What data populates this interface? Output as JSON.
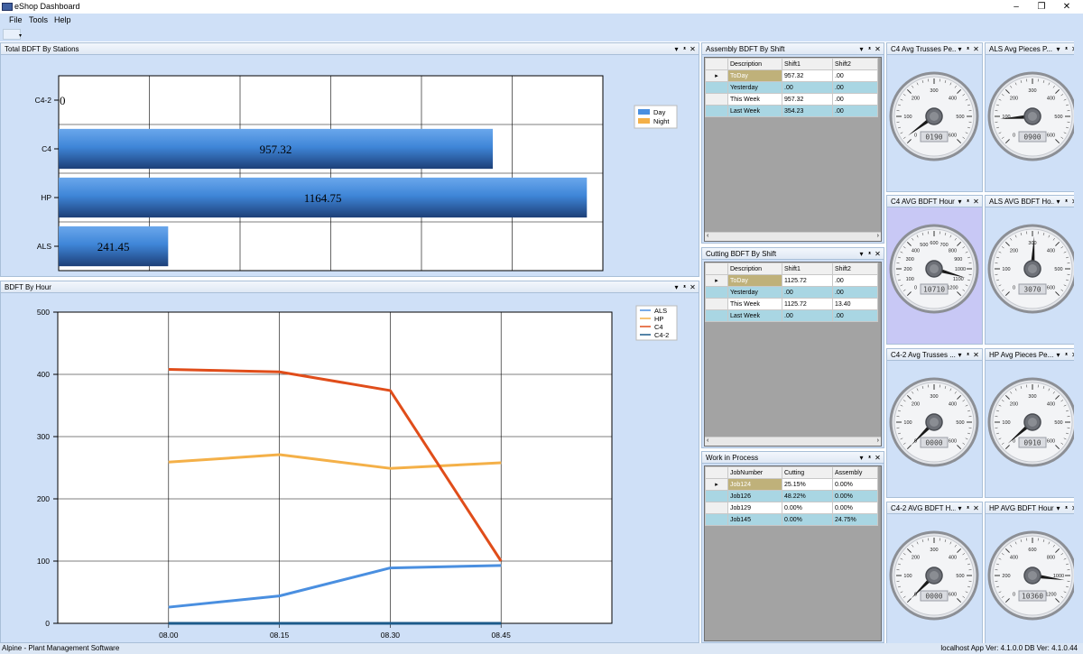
{
  "window": {
    "title": "eShop Dashboard",
    "minimize": "–",
    "restore": "❐",
    "close": "✕"
  },
  "menu": {
    "file": "File",
    "tools": "Tools",
    "help": "Help"
  },
  "toolstrip": {
    "dropdown_arrow": "▾"
  },
  "header_buttons": {
    "dropdown": "▾",
    "pin": "ᵜ",
    "close": "✕"
  },
  "stations_panel": {
    "title": "Total BDFT By Stations",
    "chart_data": {
      "type": "bar",
      "categories": [
        "C4-2",
        "C4",
        "HP",
        "ALS"
      ],
      "series": [
        {
          "name": "Day",
          "values": [
            0,
            957.32,
            1164.75,
            241.45
          ]
        },
        {
          "name": "Night",
          "values": [
            0,
            0,
            0,
            0
          ]
        }
      ],
      "data_labels": [
        "0",
        "957.32",
        "1164.75",
        "241.45"
      ],
      "xlim": [
        0,
        1200
      ],
      "x_ticks": [
        "0",
        "200",
        "400",
        "600",
        "800",
        "1000",
        "1200"
      ],
      "legend": "top-right",
      "grid": true,
      "colors": {
        "Day": "#4a8fe0",
        "Night": "#f4b048"
      }
    }
  },
  "hour_panel": {
    "title": "BDFT By Hour",
    "chart_data": {
      "type": "line",
      "x": [
        "08.00",
        "08.15",
        "08.30",
        "08.45"
      ],
      "series": [
        {
          "name": "ALS",
          "values": [
            26,
            44,
            89,
            93
          ],
          "color": "#4a8fe0"
        },
        {
          "name": "HP",
          "values": [
            259,
            271,
            249,
            258
          ],
          "color": "#f4b048"
        },
        {
          "name": "C4",
          "values": [
            408,
            404,
            374,
            100
          ],
          "color": "#e04d1a"
        },
        {
          "name": "C4-2",
          "values": [
            0,
            0,
            0,
            0
          ],
          "color": "#1c5a8a"
        }
      ],
      "ylim": [
        0,
        500
      ],
      "y_ticks": [
        "0",
        "100",
        "200",
        "300",
        "400",
        "500"
      ],
      "legend": "top-right",
      "grid": true
    }
  },
  "assembly_panel": {
    "title": "Assembly BDFT By Shift",
    "columns": [
      "Description",
      "Shift1",
      "Shift2"
    ],
    "rows": [
      [
        "ToDay",
        "957.32",
        ".00"
      ],
      [
        "Yesterday",
        ".00",
        ".00"
      ],
      [
        "This Week",
        "957.32",
        ".00"
      ],
      [
        "Last Week",
        "354.23",
        ".00"
      ]
    ],
    "current_row_marker": "▸"
  },
  "cutting_panel": {
    "title": "Cutting BDFT By Shift",
    "columns": [
      "Description",
      "Shift1",
      "Shift2"
    ],
    "rows": [
      [
        "ToDay",
        "1125.72",
        ".00"
      ],
      [
        "Yesterday",
        ".00",
        ".00"
      ],
      [
        "This Week",
        "1125.72",
        "13.40"
      ],
      [
        "Last Week",
        ".00",
        ".00"
      ]
    ],
    "current_row_marker": "▸"
  },
  "wip_panel": {
    "title": "Work in Process",
    "columns": [
      "JobNumber",
      "Cutting",
      "Assembly"
    ],
    "rows": [
      [
        "Job124",
        "25.15%",
        "0.00%"
      ],
      [
        "Job126",
        "48.22%",
        "0.00%"
      ],
      [
        "Job129",
        "0.00%",
        "0.00%"
      ],
      [
        "Job145",
        "0.00%",
        "24.75%"
      ]
    ],
    "current_row_marker": "▸"
  },
  "gauges": [
    {
      "title": "C4 Avg Trusses Pe...",
      "value": 19.0,
      "display": "0190",
      "max": 600,
      "ticks": [
        "0",
        "100",
        "200",
        "300",
        "400",
        "500",
        "600"
      ]
    },
    {
      "title": "ALS Avg Pieces P...",
      "value": 90.0,
      "display": "0900",
      "max": 600,
      "ticks": [
        "0",
        "100",
        "200",
        "300",
        "400",
        "500",
        "600"
      ]
    },
    {
      "title": "C4 AVG BDFT Hour",
      "value": 1071.0,
      "display": "10710",
      "max": 1200,
      "ticks": [
        "0",
        "100",
        "200",
        "300",
        "400",
        "500",
        "600",
        "700",
        "800",
        "900",
        "1000",
        "1100",
        "1200"
      ]
    },
    {
      "title": "ALS AVG BDFT Ho...",
      "value": 307.0,
      "display": "3070",
      "max": 600,
      "ticks": [
        "0",
        "100",
        "200",
        "300",
        "400",
        "500",
        "600"
      ]
    },
    {
      "title": "C4-2 Avg Trusses ...",
      "value": 0,
      "display": "0000",
      "max": 600,
      "ticks": [
        "0",
        "100",
        "200",
        "300",
        "400",
        "500",
        "600"
      ]
    },
    {
      "title": "HP Avg Pieces Pe...",
      "value": 9.1,
      "display": "0910",
      "max": 600,
      "ticks": [
        "0",
        "100",
        "200",
        "300",
        "400",
        "500",
        "600"
      ]
    },
    {
      "title": "C4-2 AVG BDFT H...",
      "value": 0,
      "display": "0000",
      "max": 600,
      "ticks": [
        "0",
        "100",
        "200",
        "300",
        "400",
        "500",
        "600"
      ]
    },
    {
      "title": "HP AVG BDFT Hour",
      "value": 1036.0,
      "display": "10360",
      "max": 1200,
      "ticks": [
        "0",
        "200",
        "400",
        "600",
        "800",
        "1000",
        "1200"
      ]
    }
  ],
  "status": {
    "left": "Alpine - Plant Management Software",
    "right": "localhost   App Ver:  4.1.0.0   DB Ver: 4.1.0.44"
  }
}
